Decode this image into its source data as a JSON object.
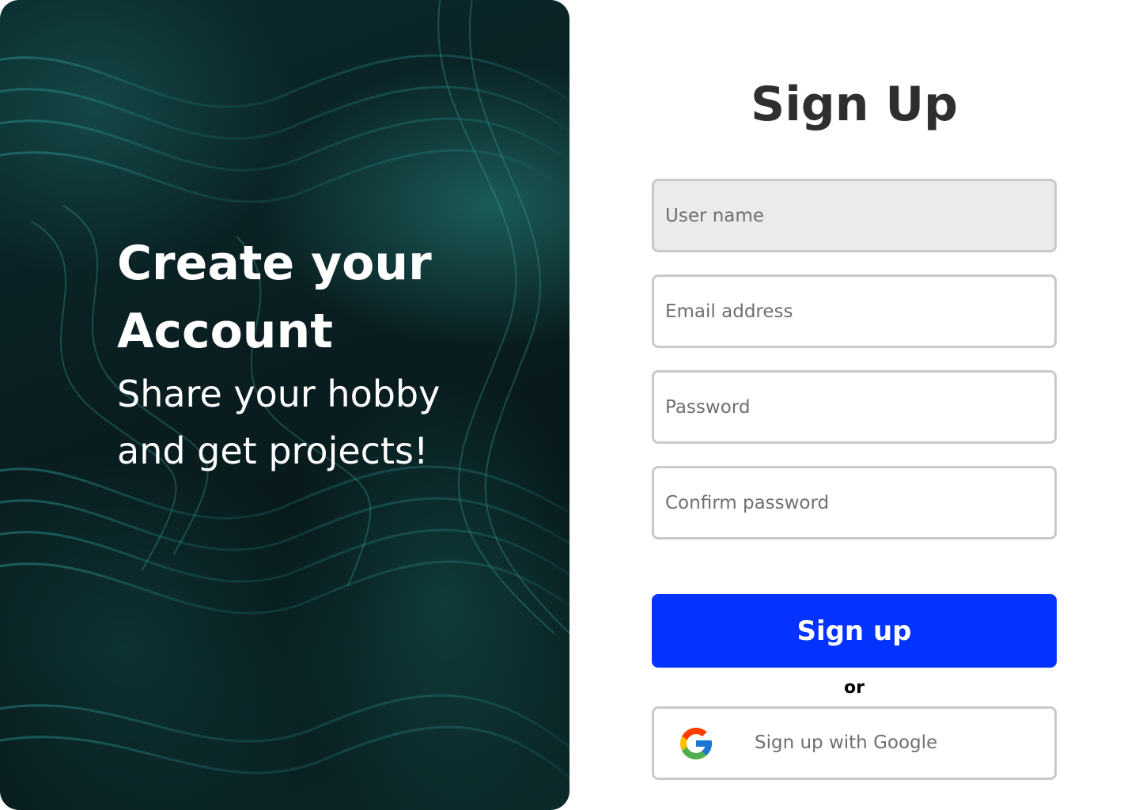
{
  "hero": {
    "title": "Create your Account",
    "subtitle": "Share your hobby and get projects!"
  },
  "form": {
    "title": "Sign Up",
    "fields": {
      "username": {
        "placeholder": "User name",
        "value": ""
      },
      "email": {
        "placeholder": "Email address",
        "value": ""
      },
      "password": {
        "placeholder": "Password",
        "value": ""
      },
      "confirm_password": {
        "placeholder": "Confirm password",
        "value": ""
      }
    },
    "submit_label": "Sign up",
    "separator": "or",
    "google_label": "Sign up with Google"
  },
  "colors": {
    "primary": "#0433ff",
    "hero_dark": "#071719",
    "hero_teal": "#1f7a74",
    "field_border": "#c9c9c9",
    "active_field_bg": "#ebebeb",
    "title_text": "#2f2f2f"
  }
}
